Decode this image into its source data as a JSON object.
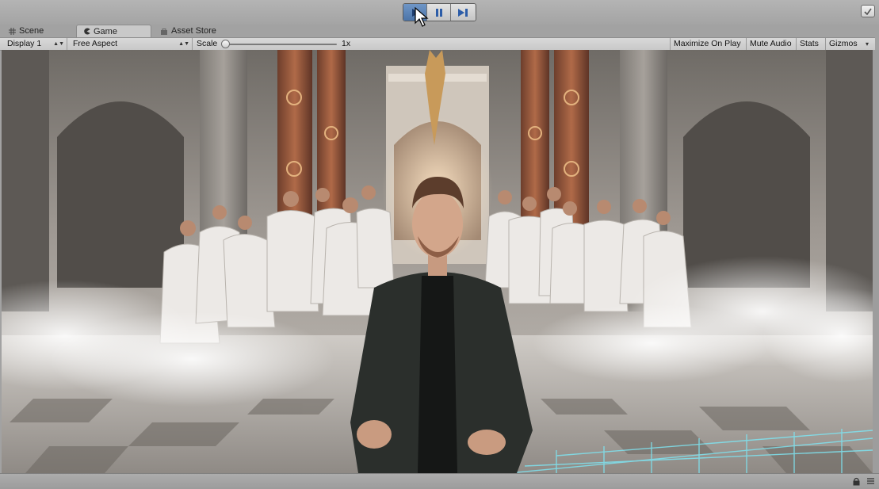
{
  "tabs": [
    {
      "label": "Scene",
      "icon": "scene-grid-icon",
      "active": false
    },
    {
      "label": "Game",
      "icon": "game-pacman-icon",
      "active": true
    },
    {
      "label": "Asset Store",
      "icon": "asset-store-icon",
      "active": false
    }
  ],
  "game_toolbar": {
    "display": "Display 1",
    "aspect": "Free Aspect",
    "scale_label": "Scale",
    "scale_value": "1x",
    "maximize_on_play": "Maximize On Play",
    "mute_audio": "Mute Audio",
    "stats": "Stats",
    "gizmos": "Gizmos"
  },
  "play_controls": {
    "play_active": true,
    "icons": [
      "play-icon",
      "pause-icon",
      "step-icon"
    ]
  },
  "colors": {
    "play_active": "#4b74a8",
    "editor_bg": "#a2a2a2",
    "hologram_grid": "#7fe3f0"
  }
}
